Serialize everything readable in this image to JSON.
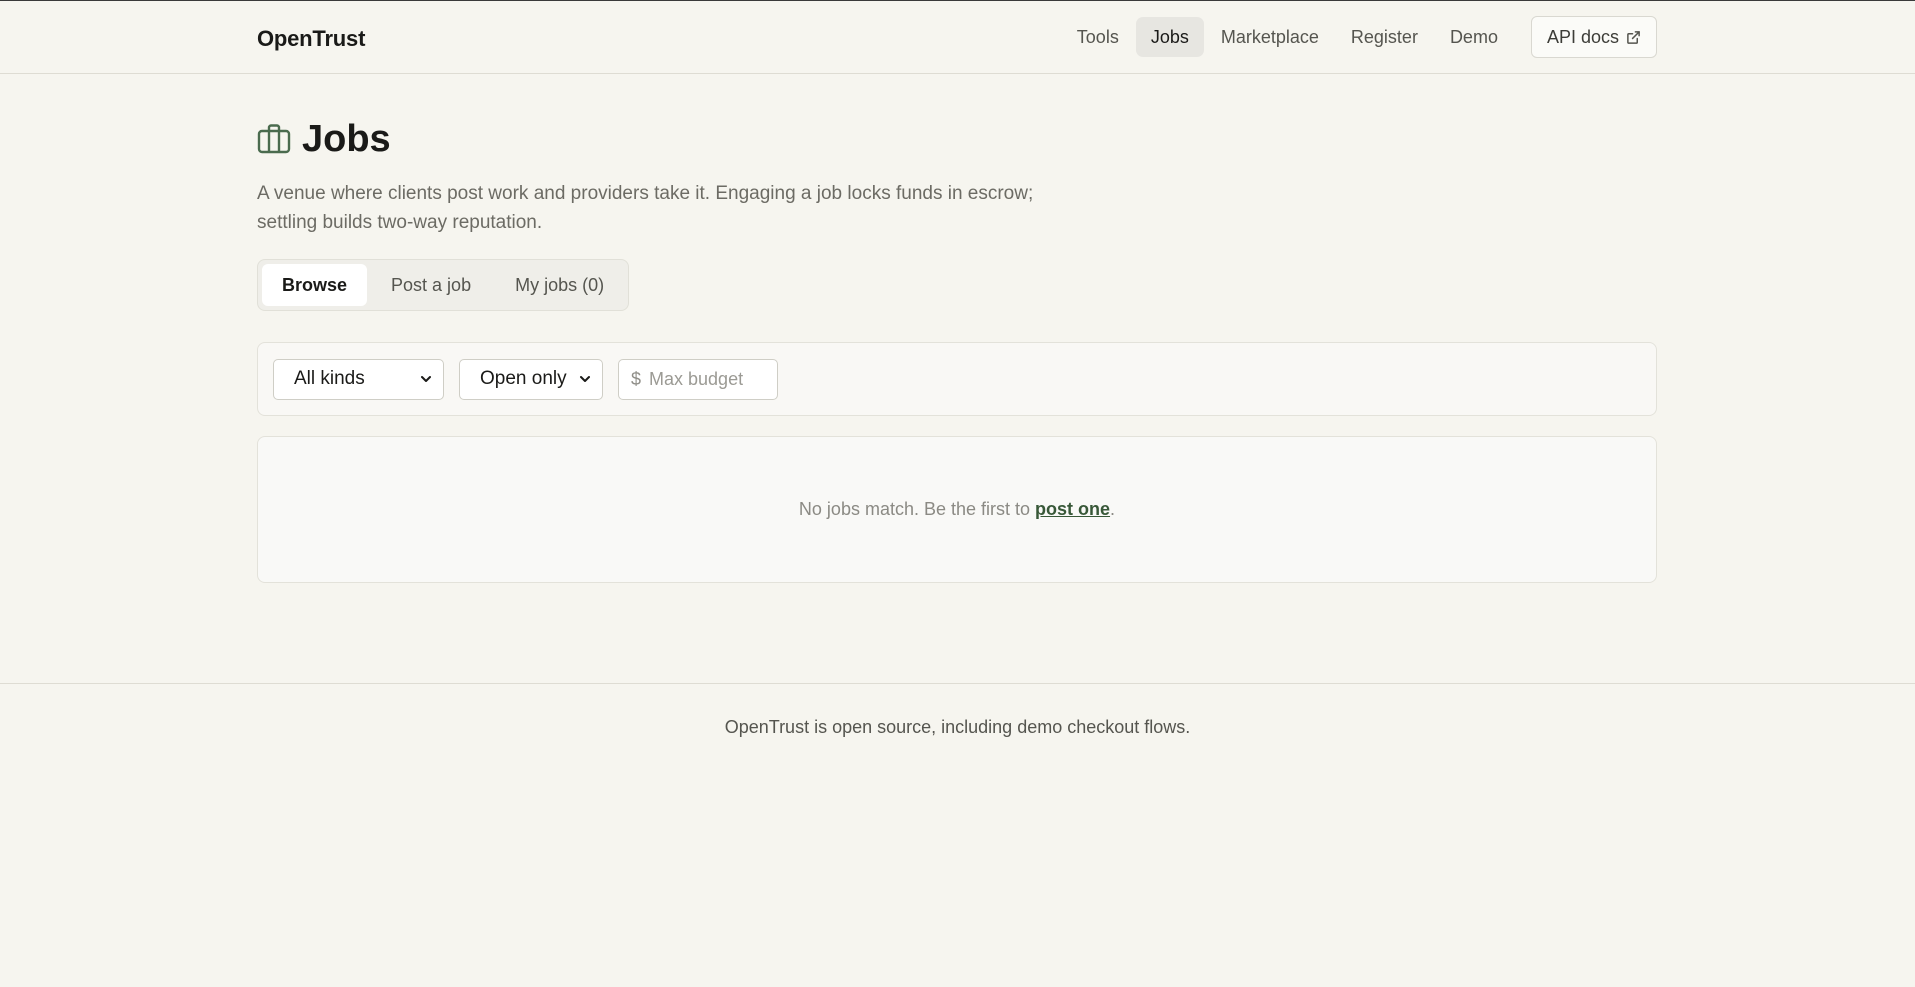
{
  "header": {
    "brand": "OpenTrust",
    "nav": [
      {
        "label": "Tools",
        "active": false
      },
      {
        "label": "Jobs",
        "active": true
      },
      {
        "label": "Marketplace",
        "active": false
      },
      {
        "label": "Register",
        "active": false
      },
      {
        "label": "Demo",
        "active": false
      }
    ],
    "api_docs_label": "API docs"
  },
  "page": {
    "icon": "briefcase-icon",
    "title": "Jobs",
    "subtitle": "A venue where clients post work and providers take it. Engaging a job locks funds in escrow; settling builds two-way reputation."
  },
  "tabs": [
    {
      "label": "Browse",
      "active": true
    },
    {
      "label": "Post a job",
      "active": false
    },
    {
      "label": "My jobs (0)",
      "active": false
    }
  ],
  "filters": {
    "kind": {
      "selected": "All kinds"
    },
    "status": {
      "selected": "Open only"
    },
    "budget": {
      "prefix": "$",
      "placeholder": "Max budget",
      "value": ""
    }
  },
  "empty_state": {
    "text": "No jobs match. Be the first to ",
    "link": "post one",
    "suffix": "."
  },
  "footer": {
    "text": "OpenTrust is open source, including demo checkout flows."
  },
  "colors": {
    "background": "#f6f5ef",
    "accent": "#385838",
    "icon": "#4a6b4e"
  }
}
